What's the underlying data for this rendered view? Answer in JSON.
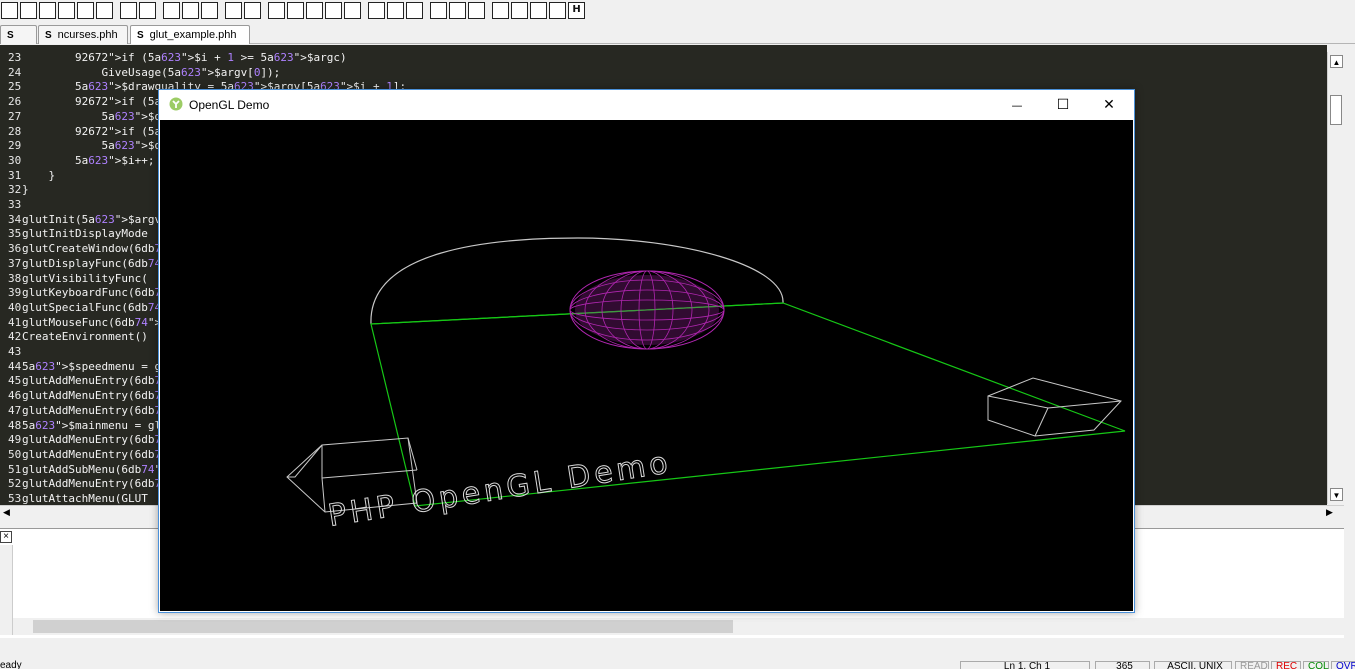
{
  "toolbar": {
    "buttons": [
      {
        "icon": "new-file-icon",
        "glyph": ""
      },
      {
        "icon": "open-folder-icon",
        "glyph": ""
      },
      {
        "icon": "open-remote-icon",
        "glyph": ""
      },
      {
        "icon": "reload-icon",
        "glyph": ""
      },
      {
        "icon": "save-icon",
        "glyph": ""
      },
      {
        "icon": "save-all-icon",
        "glyph": ""
      },
      {
        "icon": "print-icon",
        "glyph": ""
      },
      {
        "icon": "print-preview-icon",
        "glyph": ""
      },
      {
        "icon": "cut-icon",
        "glyph": ""
      },
      {
        "icon": "copy-icon",
        "glyph": ""
      },
      {
        "icon": "paste-icon",
        "glyph": ""
      },
      {
        "icon": "undo-icon",
        "glyph": ""
      },
      {
        "icon": "redo-icon",
        "glyph": ""
      },
      {
        "icon": "calculator-icon",
        "glyph": ""
      },
      {
        "icon": "find-icon",
        "glyph": ""
      },
      {
        "icon": "find-next-icon",
        "glyph": ""
      },
      {
        "icon": "replace-icon",
        "glyph": ""
      },
      {
        "icon": "find-files-icon",
        "glyph": ""
      },
      {
        "icon": "window-icon",
        "glyph": ""
      },
      {
        "icon": "tile-windows-icon",
        "glyph": ""
      },
      {
        "icon": "comment-icon",
        "glyph": ""
      },
      {
        "icon": "align-icon",
        "glyph": ""
      },
      {
        "icon": "clean-icon",
        "glyph": ""
      },
      {
        "icon": "list-icon",
        "glyph": ""
      },
      {
        "icon": "collapse-icon",
        "glyph": ""
      },
      {
        "icon": "expand-icon",
        "glyph": ""
      },
      {
        "icon": "split-icon",
        "glyph": ""
      },
      {
        "icon": "fullscreen-icon",
        "glyph": ""
      },
      {
        "icon": "help-icon",
        "glyph": "H"
      }
    ]
  },
  "tabs": [
    {
      "icon": "S",
      "label": ""
    },
    {
      "icon": "S",
      "label": "ncurses.phh"
    },
    {
      "icon": "S",
      "label": "glut_example.phh"
    }
  ],
  "editor": {
    "lines": [
      {
        "n": "23",
        "text": "        if ($i + 1 >= $argc)"
      },
      {
        "n": "24",
        "text": "            GiveUsage($argv[0]);"
      },
      {
        "n": "25",
        "text": "        $drawquality = $argv[$i + 1];"
      },
      {
        "n": "26",
        "text": "        if ($drawqu"
      },
      {
        "n": "27",
        "text": "            $drawqu"
      },
      {
        "n": "28",
        "text": "        if ($drawqu"
      },
      {
        "n": "29",
        "text": "            $drawqu"
      },
      {
        "n": "30",
        "text": "        $i++;"
      },
      {
        "n": "31",
        "text": "    }"
      },
      {
        "n": "32",
        "text": "}"
      },
      {
        "n": "33",
        "text": ""
      },
      {
        "n": "34",
        "text": "glutInit($argv);"
      },
      {
        "n": "35",
        "text": "glutInitDisplayMode"
      },
      {
        "n": "36",
        "text": "glutCreateWindow(\"O"
      },
      {
        "n": "37",
        "text": "glutDisplayFunc('Di"
      },
      {
        "n": "38",
        "text": "glutVisibilityFunc("
      },
      {
        "n": "39",
        "text": "glutKeyboardFunc('H"
      },
      {
        "n": "40",
        "text": "glutSpecialFunc('Ha"
      },
      {
        "n": "41",
        "text": "glutMouseFunc('Hand"
      },
      {
        "n": "42",
        "text": "CreateEnvironment()"
      },
      {
        "n": "43",
        "text": ""
      },
      {
        "n": "44",
        "text": "$speedmenu = glutCr"
      },
      {
        "n": "45",
        "text": "glutAddMenuEntry(\"S"
      },
      {
        "n": "46",
        "text": "glutAddMenuEntry(\"M"
      },
      {
        "n": "47",
        "text": "glutAddMenuEntry(\"f"
      },
      {
        "n": "48",
        "text": "$mainmenu = glutCre"
      },
      {
        "n": "49",
        "text": "glutAddMenuEntry(\"T"
      },
      {
        "n": "50",
        "text": "glutAddMenuEntry(\"T"
      },
      {
        "n": "51",
        "text": "glutAddSubMenu(\"Bal"
      },
      {
        "n": "52",
        "text": "glutAddMenuEntry(\"Q"
      },
      {
        "n": "53",
        "text": "glutAttachMenu(GLUT"
      }
    ]
  },
  "output": {
    "close_glyph": "×"
  },
  "statusbar": {
    "message": "eady",
    "position": "Ln 1, Ch 1",
    "count": "365",
    "encoding": "ASCII, UNIX",
    "read": "READ",
    "rec": "REC",
    "col": "COL",
    "ovr": "OVR"
  },
  "gl_window": {
    "title": "OpenGL Demo",
    "minimize_glyph": "—",
    "maximize_glyph": "☐",
    "close_glyph": "✕",
    "scene_text": "PHP   OpenGL   Demo",
    "colors": {
      "background": "#000000",
      "floor": "#16c716",
      "sphere": "#b026b0",
      "wire": "#c8c8c8"
    }
  }
}
